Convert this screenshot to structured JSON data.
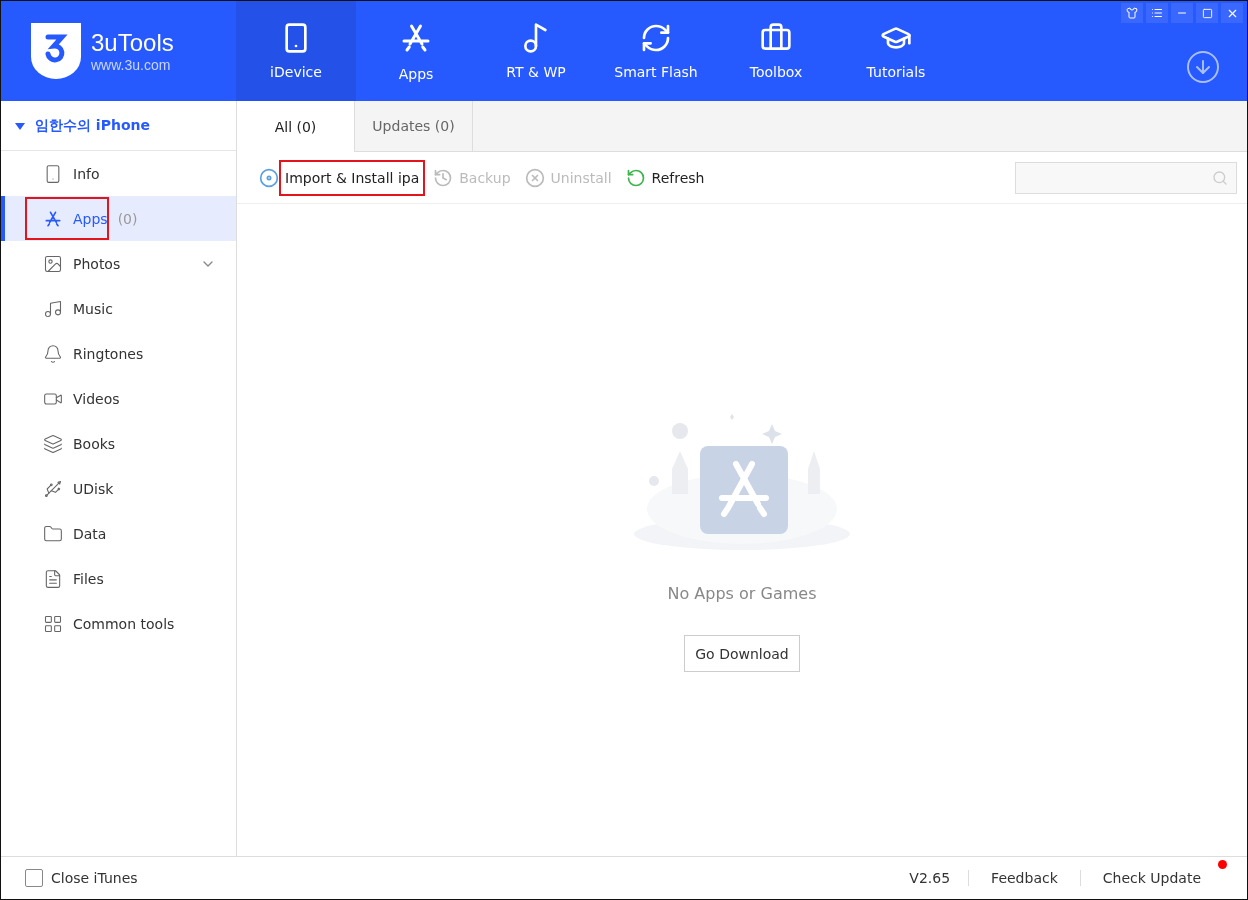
{
  "logo": {
    "name": "3uTools",
    "url": "www.3u.com"
  },
  "nav": [
    {
      "label": "iDevice",
      "selected": true
    },
    {
      "label": "Apps",
      "selected": false
    },
    {
      "label": "RT & WP",
      "selected": false
    },
    {
      "label": "Smart Flash",
      "selected": false
    },
    {
      "label": "Toolbox",
      "selected": false
    },
    {
      "label": "Tutorials",
      "selected": false
    }
  ],
  "device": {
    "name": "임한수의 iPhone",
    "expanded": true
  },
  "sidebar": {
    "items": [
      {
        "label": "Info",
        "selected": false,
        "highlighted": false,
        "expandable": false
      },
      {
        "label": "Apps",
        "count": "(0)",
        "selected": true,
        "highlighted": true,
        "expandable": false
      },
      {
        "label": "Photos",
        "selected": false,
        "highlighted": false,
        "expandable": true
      },
      {
        "label": "Music",
        "selected": false,
        "highlighted": false,
        "expandable": false
      },
      {
        "label": "Ringtones",
        "selected": false,
        "highlighted": false,
        "expandable": false
      },
      {
        "label": "Videos",
        "selected": false,
        "highlighted": false,
        "expandable": false
      },
      {
        "label": "Books",
        "selected": false,
        "highlighted": false,
        "expandable": false
      },
      {
        "label": "UDisk",
        "selected": false,
        "highlighted": false,
        "expandable": false
      },
      {
        "label": "Data",
        "selected": false,
        "highlighted": false,
        "expandable": false
      },
      {
        "label": "Files",
        "selected": false,
        "highlighted": false,
        "expandable": false
      },
      {
        "label": "Common tools",
        "selected": false,
        "highlighted": false,
        "expandable": false
      }
    ]
  },
  "tabs": [
    {
      "label": "All (0)",
      "selected": true
    },
    {
      "label": "Updates (0)",
      "selected": false
    }
  ],
  "toolbar": [
    {
      "label": "Import & Install ipa",
      "disabled": false,
      "highlighted": true
    },
    {
      "label": "Backup",
      "disabled": true,
      "highlighted": false
    },
    {
      "label": "Uninstall",
      "disabled": true,
      "highlighted": false
    },
    {
      "label": "Refresh",
      "disabled": false,
      "highlighted": false
    }
  ],
  "empty": {
    "message": "No Apps or Games",
    "button": "Go Download"
  },
  "status_bar": {
    "close_itunes": {
      "label": "Close iTunes",
      "checked": false
    },
    "version": "V2.65",
    "feedback": "Feedback",
    "check_update": {
      "label": "Check Update",
      "badge": true
    }
  }
}
